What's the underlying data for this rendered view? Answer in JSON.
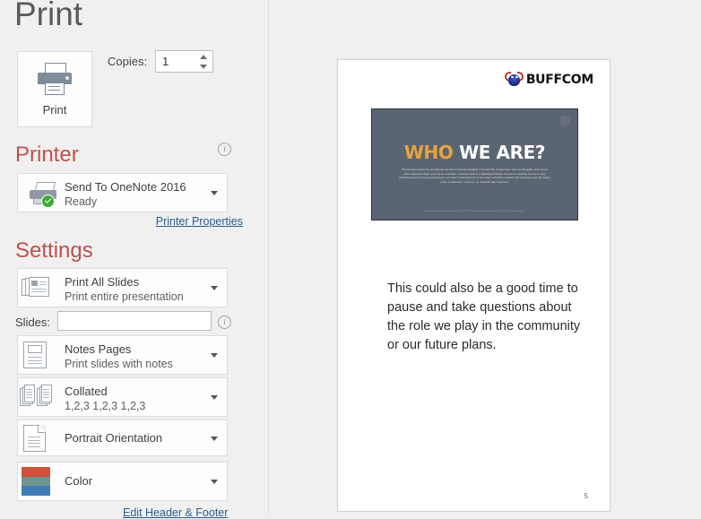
{
  "page": {
    "title": "Print"
  },
  "print_action": {
    "label": "Print",
    "icon": "printer-icon"
  },
  "copies": {
    "label": "Copies:",
    "value": "1"
  },
  "printer": {
    "heading": "Printer",
    "name": "Send To OneNote 2016",
    "status": "Ready",
    "properties_link": "Printer Properties",
    "info_icon": "i",
    "status_icon": "green-check-icon"
  },
  "settings": {
    "heading": "Settings",
    "range": {
      "title": "Print All Slides",
      "subtitle": "Print entire presentation",
      "icon": "slides-stack-icon"
    },
    "slides_field": {
      "label": "Slides:",
      "value": "",
      "placeholder": "",
      "info_icon": "i"
    },
    "layout": {
      "title": "Notes Pages",
      "subtitle": "Print slides with notes",
      "icon": "notes-page-icon"
    },
    "collation": {
      "title": "Collated",
      "subtitle": "1,2,3   1,2,3   1,2,3",
      "icon": "collate-icon"
    },
    "orientation": {
      "title": "Portrait Orientation",
      "icon": "portrait-page-icon"
    },
    "color": {
      "title": "Color",
      "icon": "color-swatch-icon"
    },
    "edit_header_footer_link": "Edit Header & Footer"
  },
  "preview": {
    "brand": {
      "text": "BUFFCOM",
      "icon": "buffalo-head-logo-icon"
    },
    "slide": {
      "title_accent": "WHO",
      "title_plain": " WE ARE?",
      "body": "Phenomenon  whereby something new and somehow valuable is formed the created item may be intangible  such as an idea a physical object such as an invention,  a literary work or a painting scholarly interest  in creativity  involves many definitions  and concepts pertaining  to a number of disciplines it is summary  scientific research  into creativity over the nature of the contribution, however, no scientific has examined.",
      "footer": "Lorem ipsum dolor sit amet consectetur\n© 2019 all rights reserved by company  |  Terms  |  All rights reserved",
      "watermark_icon": "circle-watermark-icon"
    },
    "notes": "This could also be a good time to pause and take questions about the role we play in the community or our future plans.",
    "page_number": "5"
  },
  "colors": {
    "accent_heading": "#c0504d",
    "link": "#2a5b8c",
    "slide_bg": "#5b6572",
    "slide_accent": "#e8a33d",
    "swatch_top": "#d1513c",
    "swatch_mid": "#6f9490",
    "swatch_bottom": "#3f7cb8"
  }
}
